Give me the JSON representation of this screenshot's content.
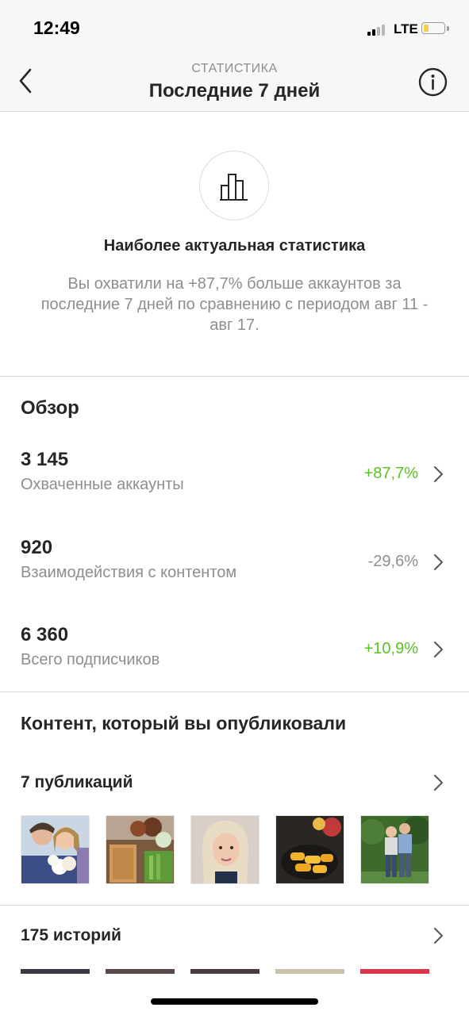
{
  "status_bar": {
    "time": "12:49",
    "network": "LTE",
    "battery_fraction": 0.25
  },
  "nav": {
    "subtitle": "СТАТИСТИКА",
    "title": "Последние 7 дней"
  },
  "highlight": {
    "icon": "bar-chart-icon",
    "title": "Наиболее актуальная статистика",
    "text": "Вы охватили на +87,7% больше аккаунтов за последние 7 дней по сравнению с периодом авг 11 - авг 17."
  },
  "overview": {
    "title": "Обзор",
    "metrics": [
      {
        "value": "3 145",
        "label": "Охваченные аккаунты",
        "change": "+87,7%",
        "trend": "up"
      },
      {
        "value": "920",
        "label": "Взаимодействия с контентом",
        "change": "-29,6%",
        "trend": "down"
      },
      {
        "value": "6 360",
        "label": "Всего подписчиков",
        "change": "+10,9%",
        "trend": "up"
      }
    ]
  },
  "content": {
    "title": "Контент, который вы опубликовали",
    "posts_label": "7 публикаций",
    "stories_label": "175 историй",
    "post_thumbnails": [
      "children-with-flowers",
      "food-table",
      "woman-selfie",
      "mango-slices",
      "couple-outdoors"
    ]
  },
  "colors": {
    "positive": "#58c322",
    "neutral": "#8e8e8e",
    "divider": "#dbdbdb"
  }
}
